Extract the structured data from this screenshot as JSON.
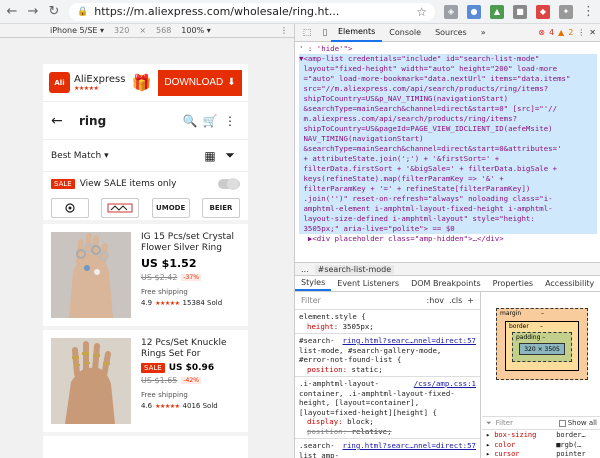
{
  "browser": {
    "url": "https://m.aliexpress.com/wholesale/ring.ht..."
  },
  "device_toolbar": {
    "device": "iPhone 5/SE ▾",
    "width": "320",
    "times": "×",
    "height": "568",
    "zoom": "100% ▾"
  },
  "app": {
    "brand_name": "AliExpress",
    "brand_stars": "★★★★★",
    "logo_text": "AliExpress",
    "download_label": "DOWNLOAD",
    "search_query": "ring",
    "sort_label": "Best Match ▾",
    "sale_badge": "SALE",
    "sale_filter_label": "View SALE items only",
    "brands": [
      "UMODE",
      "BEIER"
    ],
    "products": [
      {
        "title": "IG 15 Pcs/set Crystal Flower Silver Ring Se...",
        "price": "US $1.52",
        "orig_price": "US $2.42",
        "discount": "-37%",
        "shipping": "Free shipping",
        "rating": "4.9",
        "stars": "★★★★★",
        "sold": "15384 Sold"
      },
      {
        "title": "12 Pcs/Set Knuckle Rings Set For Women...",
        "sale_badge": "SALE",
        "price": "US $0.96",
        "orig_price": "US $1.65",
        "discount": "-42%",
        "shipping": "Free shipping",
        "rating": "4.6",
        "stars": "★★★★★",
        "sold": "4016 Sold"
      }
    ]
  },
  "devtools": {
    "tabs": [
      "Elements",
      "Console",
      "Sources",
      "»"
    ],
    "errors": "4",
    "warnings": "2",
    "dom_lines": [
      "' : 'hide'\">",
      "▼<amp-list credentials=\"include\" id=\"search-list-mode\"",
      " layout=\"fixed-height\" width=\"auto\" height=\"200\" load-more",
      " =\"auto\" load-more-bookmark=\"data.nextUrl\" items=\"data.items\"",
      " src=\"//m.aliexpress.com/api/search/products/ring/items?",
      " shipToCountry=US&p_NAV_TIMING(navigationStart)",
      " &searchType=mainSearch&channel=direct&start=0\" [src]=\"'//",
      " m.aliexpress.com/api/search/products/ring/items?",
      " shipToCountry=US&pageId=PAGE_VIEW_IDCLIENT_ID(aefeMsite)",
      " NAV_TIMING(navigationStart)",
      " &searchType=mainSearch&channel=direct&start=0&attributes='",
      " + attributeState.join(';') + '&firstSort=' +",
      " filterData.firstSort + '&bigSale=' + filterData.bigSale +",
      " keys(refineState).map(filterParamKey => '&' +",
      " filterParamKey + '=' + refineState[filterParamKey])",
      " .join('')\" reset-on-refresh=\"always\" noloading class=\"i-",
      " amphtml-element i-amphtml-layout-fixed-height i-amphtml-",
      " layout-size-defined i-amphtml-layout\" style=\"height:",
      " 3505px;\" aria-live=\"polite\"> == $0",
      "  ▶<div placeholder class=\"amp-hidden\">…</div>"
    ],
    "breadcrumb": [
      "...",
      "#search-list-mode"
    ],
    "sub_tabs": [
      "Styles",
      "Event Listeners",
      "DOM Breakpoints",
      "Properties",
      "Accessibility"
    ],
    "filter_placeholder": "Filter",
    "hov_label": ":hov",
    "cls_label": ".cls",
    "plus": "+",
    "rules": [
      {
        "selector": "element.style {",
        "source": "",
        "props": [
          {
            "p": "height",
            "v": "3505px;",
            "strike": false
          }
        ]
      },
      {
        "selector": "#search-list-mode, #search-gallery-mode, #error-not-found-list {",
        "source": "ring.html?searc…nnel=direct:57",
        "props": [
          {
            "p": "position",
            "v": "static;",
            "strike": false
          }
        ]
      },
      {
        "selector": ".i-amphtml-layout-container, .i-amphtml-layout-fixed-height, [layout=container], [layout=fixed-height][height] {",
        "source": "/css/amp.css:1",
        "props": [
          {
            "p": "display",
            "v": "block;",
            "strike": false
          },
          {
            "p": "position",
            "v": "relative;",
            "strike": true
          }
        ]
      },
      {
        "selector": ".search-list amp-",
        "source": "ring.html?searc…nnel=direct:57",
        "props": []
      }
    ],
    "box_model": {
      "margin_label": "margin",
      "margin_dash": "–",
      "border_label": "border",
      "border_dash": "–",
      "padding_label": "padding –",
      "content_size": "320 × 3505"
    },
    "computed_filter": "Filter",
    "show_all": "Show all",
    "computed": [
      {
        "p": "box-sizing",
        "v": "border…"
      },
      {
        "p": "color",
        "v": "■rgb(…"
      },
      {
        "p": "cursor",
        "v": "pointer"
      },
      {
        "p": "display",
        "v": "block"
      },
      {
        "p": "font-family",
        "v": "Roboto…"
      }
    ]
  },
  "colors": {
    "accent": "#e62e04",
    "devtools_blue": "#1a73e8"
  }
}
